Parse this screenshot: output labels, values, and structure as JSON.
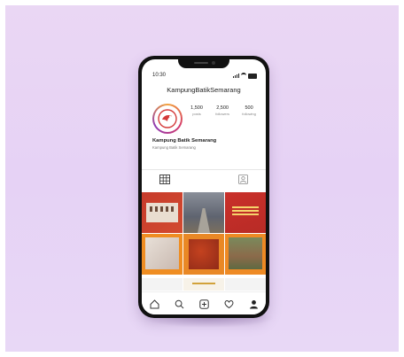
{
  "status_bar": {
    "time": "10:30"
  },
  "profile": {
    "username": "KampungBatikSemarang",
    "display_name": "Kampung Batik Semarang",
    "bio": "Kampung Batik Semarang",
    "stats": [
      {
        "value": "1,500",
        "label": "posts"
      },
      {
        "value": "2,500",
        "label": "followers"
      },
      {
        "value": "500",
        "label": "following"
      }
    ]
  },
  "tabs": [
    {
      "icon": "grid-icon"
    },
    {
      "icon": "tagged-icon"
    }
  ],
  "bottom_nav": [
    {
      "icon": "home-icon"
    },
    {
      "icon": "search-icon"
    },
    {
      "icon": "add-post-icon"
    },
    {
      "icon": "heart-icon"
    },
    {
      "icon": "profile-icon"
    }
  ],
  "colors": {
    "backdrop": "#e6d2f5",
    "brand_red": "#c73b2b",
    "brand_orange": "#ef8d22"
  }
}
